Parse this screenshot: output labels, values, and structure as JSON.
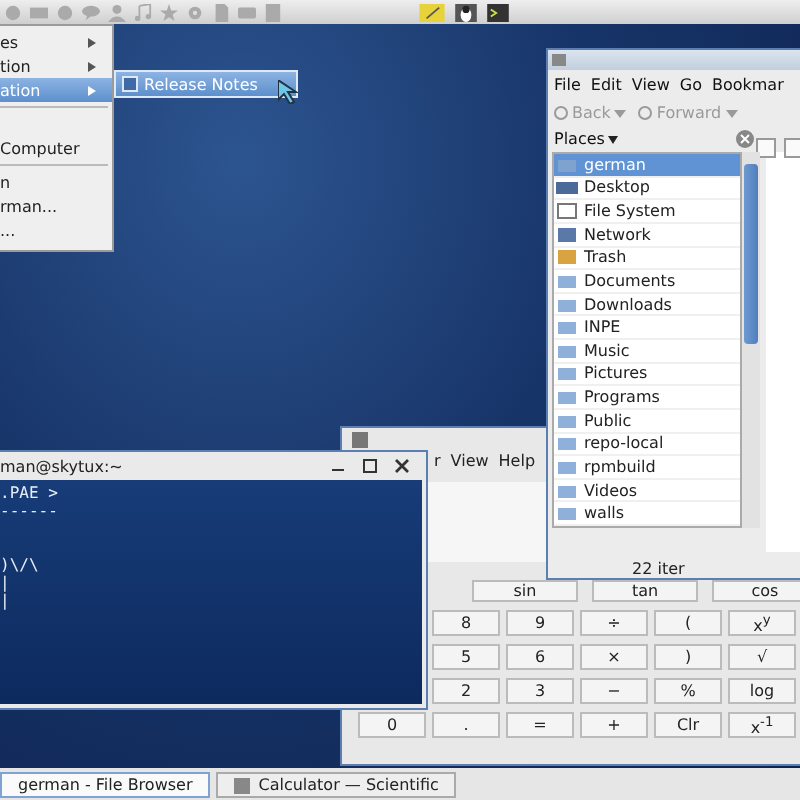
{
  "menu": {
    "items": [
      {
        "kind": "item",
        "label": "es",
        "submenu": true,
        "selected": false
      },
      {
        "kind": "item",
        "label": "tion",
        "submenu": true,
        "selected": false
      },
      {
        "kind": "item",
        "label": "ation",
        "submenu": true,
        "selected": true
      },
      {
        "kind": "separator"
      },
      {
        "kind": "item",
        "label": "Computer",
        "submenu": false,
        "selected": false
      },
      {
        "kind": "separator"
      },
      {
        "kind": "item",
        "label": "n",
        "submenu": false,
        "selected": false
      },
      {
        "kind": "item",
        "label": "rman...",
        "submenu": false,
        "selected": false
      },
      {
        "kind": "item",
        "label": "...",
        "submenu": false,
        "selected": false
      }
    ]
  },
  "submenu": {
    "items": [
      {
        "label": "Release Notes",
        "selected": true
      }
    ]
  },
  "file_browser": {
    "menubar": [
      "File",
      "Edit",
      "View",
      "Go",
      "Bookmar"
    ],
    "toolbar": [
      {
        "label": "Back",
        "disabled": true
      },
      {
        "label": "Forward",
        "disabled": true
      }
    ],
    "places_label": "Places",
    "places": [
      {
        "label": "german",
        "kind": "home",
        "selected": true
      },
      {
        "label": "Desktop",
        "kind": "desktop",
        "selected": false
      },
      {
        "label": "File System",
        "kind": "drive",
        "selected": false
      },
      {
        "label": "Network",
        "kind": "network",
        "selected": false
      },
      {
        "label": "Trash",
        "kind": "trash",
        "selected": false
      },
      {
        "label": "Documents",
        "kind": "folder",
        "selected": false
      },
      {
        "label": "Downloads",
        "kind": "folder",
        "selected": false
      },
      {
        "label": "INPE",
        "kind": "folder",
        "selected": false
      },
      {
        "label": "Music",
        "kind": "folder",
        "selected": false
      },
      {
        "label": "Pictures",
        "kind": "folder",
        "selected": false
      },
      {
        "label": "Programs",
        "kind": "folder",
        "selected": false
      },
      {
        "label": "Public",
        "kind": "folder",
        "selected": false
      },
      {
        "label": "repo-local",
        "kind": "folder",
        "selected": false
      },
      {
        "label": "rpmbuild",
        "kind": "folder",
        "selected": false
      },
      {
        "label": "Videos",
        "kind": "folder",
        "selected": false
      },
      {
        "label": "walls",
        "kind": "folder",
        "selected": false
      }
    ],
    "status": "22 iter"
  },
  "calculator": {
    "menubar": [
      "r",
      "View",
      "Help"
    ],
    "function_row": [
      "sin",
      "tan",
      "cos"
    ],
    "keypad": [
      [
        "8",
        "9",
        "÷",
        "(",
        "x$^{y}$"
      ],
      [
        "5",
        "6",
        "×",
        ")",
        "√"
      ],
      [
        "2",
        "3",
        "−",
        "%",
        "log"
      ],
      [
        "0",
        ".",
        "=",
        "+",
        "Clr",
        "x$^{-1}$"
      ]
    ]
  },
  "terminal": {
    "title": "man@skytux:~",
    "output": ".PAE >\n------\n\n\n)\\/\\\n|\n|"
  },
  "taskbar": [
    {
      "label": "german - File Browser",
      "selected": true
    },
    {
      "label": "Calculator — Scientific",
      "selected": false
    }
  ]
}
